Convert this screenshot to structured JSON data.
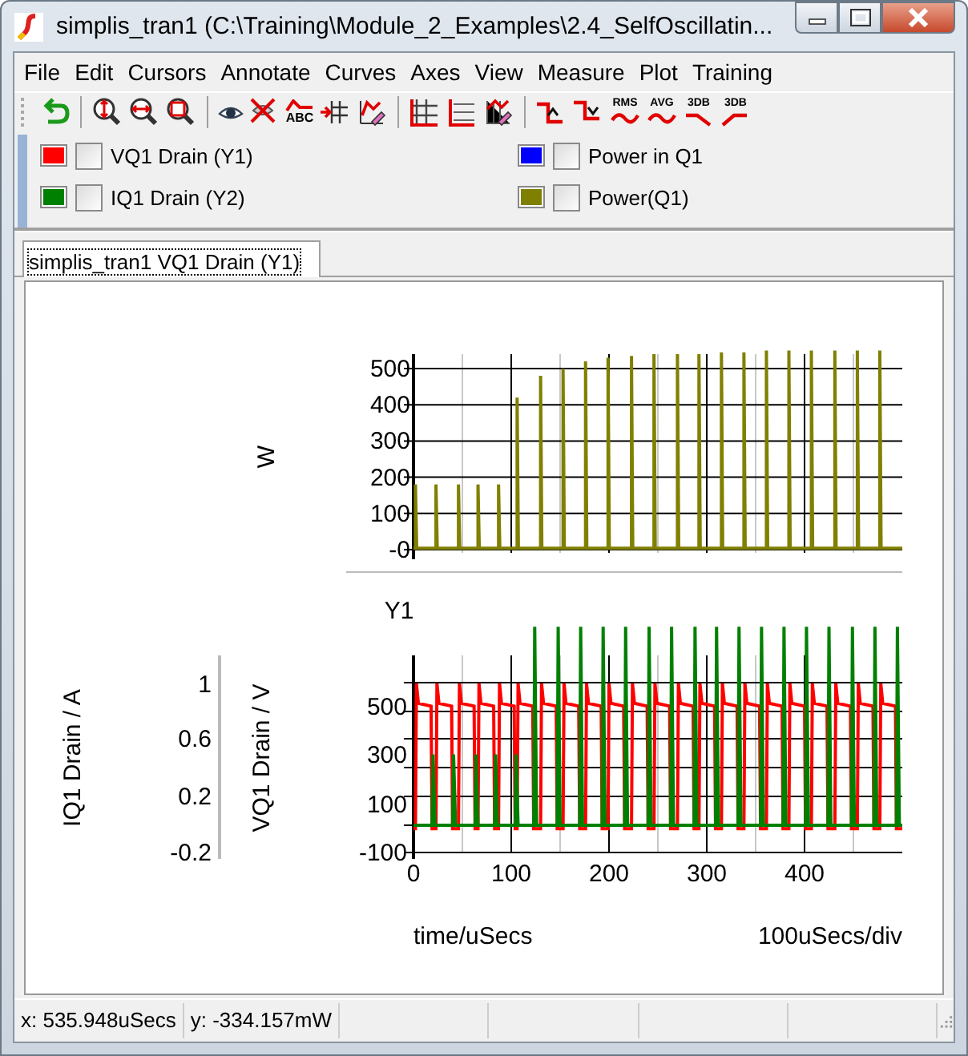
{
  "window": {
    "title": "simplis_tran1 (C:\\Training\\Module_2_Examples\\2.4_SelfOscillatin..."
  },
  "menu": [
    "File",
    "Edit",
    "Cursors",
    "Annotate",
    "Curves",
    "Axes",
    "View",
    "Measure",
    "Plot",
    "Training"
  ],
  "toolbar": [
    {
      "kind": "undo"
    },
    {
      "kind": "separator"
    },
    {
      "kind": "zoom-vertical"
    },
    {
      "kind": "zoom-horizontal"
    },
    {
      "kind": "zoom-box"
    },
    {
      "kind": "separator"
    },
    {
      "kind": "eye"
    },
    {
      "kind": "delete-curve"
    },
    {
      "kind": "label-curve",
      "label": "ABC"
    },
    {
      "kind": "arrow-grid"
    },
    {
      "kind": "edit-curve"
    },
    {
      "kind": "separator"
    },
    {
      "kind": "grid"
    },
    {
      "kind": "axis-lines"
    },
    {
      "kind": "edit-axes"
    },
    {
      "kind": "separator"
    },
    {
      "kind": "rise"
    },
    {
      "kind": "fall"
    },
    {
      "kind": "wave-text",
      "label": "RMS"
    },
    {
      "kind": "wave-text",
      "label": "AVG"
    },
    {
      "kind": "falling-text",
      "label": "3DB"
    },
    {
      "kind": "rising-text",
      "label": "3DB"
    }
  ],
  "curves": [
    {
      "name": "VQ1 Drain (Y1)",
      "color": "#ff0000",
      "checked": false
    },
    {
      "name": "Power in Q1",
      "color": "#0000ff",
      "checked": false
    },
    {
      "name": "IQ1 Drain (Y2)",
      "color": "#008000",
      "checked": false
    },
    {
      "name": "Power(Q1)",
      "color": "#808000",
      "checked": false
    }
  ],
  "tabs": [
    {
      "label": "simplis_tran1 VQ1 Drain (Y1)",
      "selected": true
    }
  ],
  "plot_top": {
    "y_label": "W",
    "y_ticks": [
      "500",
      "400",
      "300",
      "200",
      "100",
      "-0"
    ]
  },
  "plot_bottom": {
    "header": "Y1",
    "y2_label": "IQ1 Drain / A",
    "y2_ticks": [
      "1",
      "0.6",
      "0.2",
      "-0.2"
    ],
    "y1_label": "VQ1 Drain / V",
    "y1_ticks": [
      "500",
      "300",
      "100",
      "-100"
    ],
    "x_ticks": [
      "0",
      "100",
      "200",
      "300",
      "400"
    ],
    "x_label": "time/uSecs",
    "scale": "100uSecs/div"
  },
  "status_bar": [
    "x: 535.948uSecs",
    "y: -334.157mW"
  ]
}
